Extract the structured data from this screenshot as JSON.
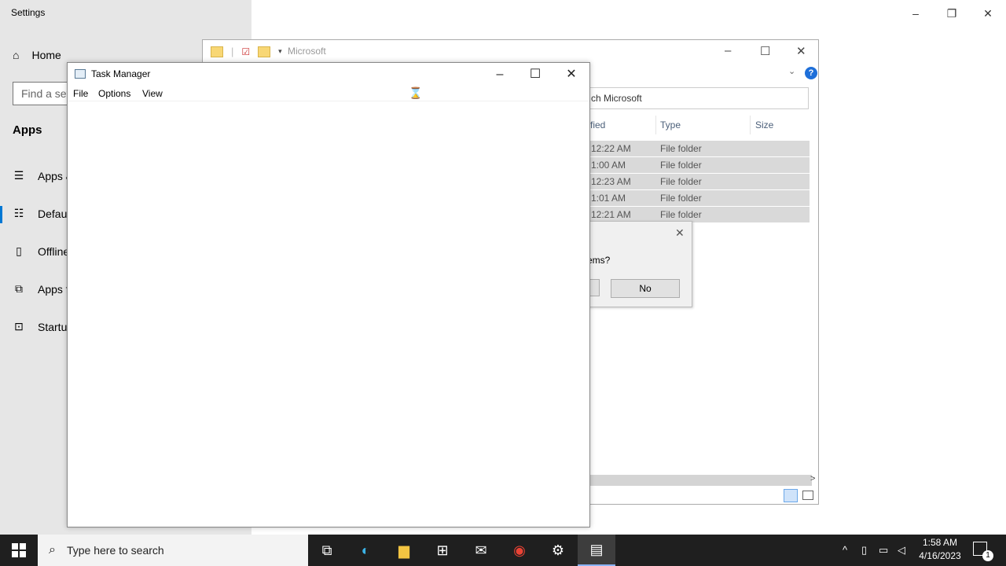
{
  "settings": {
    "title": "Settings",
    "home": "Home",
    "search_placeholder": "Find a set",
    "section": "Apps",
    "items": [
      "Apps &",
      "Defaul",
      "Offline",
      "Apps f",
      "Startup"
    ]
  },
  "explorer": {
    "title": "Microsoft",
    "search": "ch Microsoft",
    "columns": {
      "modified": "fied",
      "type": "Type",
      "size": "Size"
    },
    "rows": [
      {
        "time": "12:22 AM",
        "type": "File folder"
      },
      {
        "time": "1:00 AM",
        "type": "File folder"
      },
      {
        "time": "12:23 AM",
        "type": "File folder"
      },
      {
        "time": "1:01 AM",
        "type": "File folder"
      },
      {
        "time": "12:21 AM",
        "type": "File folder"
      }
    ],
    "help": "?"
  },
  "dialog": {
    "question": "ems?",
    "no_label": "No"
  },
  "taskmgr": {
    "title": "Task Manager",
    "menu": [
      "File",
      "Options",
      "View"
    ]
  },
  "taskbar": {
    "search_placeholder": "Type here to search",
    "time": "1:58 AM",
    "date": "4/16/2023",
    "notification_count": "1",
    "apps": [
      "task-view-icon",
      "edge-icon",
      "file-explorer-icon",
      "store-icon",
      "mail-icon",
      "chrome-icon",
      "settings-icon",
      "task-manager-icon"
    ]
  }
}
